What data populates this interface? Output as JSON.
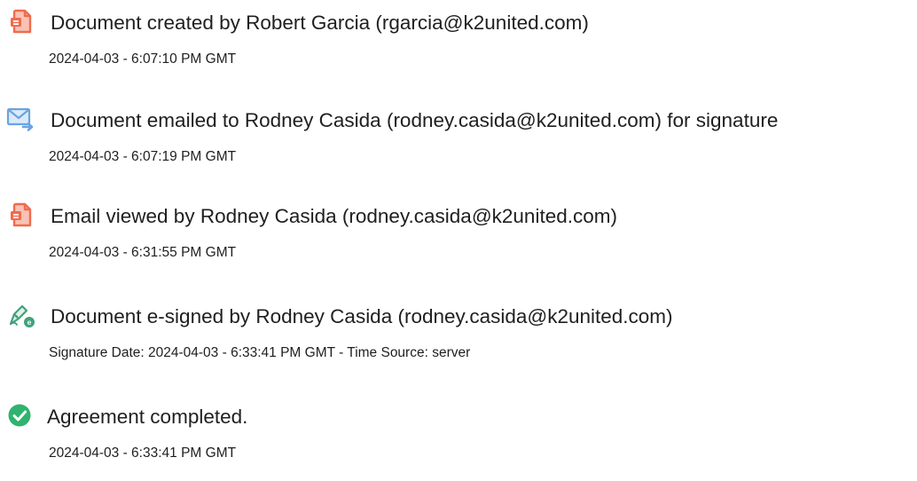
{
  "events": [
    {
      "icon": "document-created-icon",
      "title": "Document created by Robert Garcia (rgarcia@k2united.com)",
      "meta": "2024-04-03 - 6:07:10 PM GMT"
    },
    {
      "icon": "email-sent-icon",
      "title": "Document emailed to Rodney Casida (rodney.casida@k2united.com) for signature",
      "meta": "2024-04-03 - 6:07:19 PM GMT"
    },
    {
      "icon": "email-viewed-icon",
      "title": "Email viewed by Rodney Casida (rodney.casida@k2united.com)",
      "meta": "2024-04-03 - 6:31:55 PM GMT"
    },
    {
      "icon": "e-signature-pen-icon",
      "title": "Document e-signed by Rodney Casida (rodney.casida@k2united.com)",
      "meta": "Signature Date: 2024-04-03 - 6:33:41 PM GMT - Time Source: server"
    },
    {
      "icon": "check-circle-icon",
      "title": "Agreement completed.",
      "meta": "2024-04-03 - 6:33:41 PM GMT"
    }
  ],
  "colors": {
    "document_icon": "#f06b4d",
    "email_icon": "#6aa3e0",
    "signature_icon": "#3fa37a",
    "complete_icon": "#2fb36e",
    "text": "#1f1f1f"
  }
}
